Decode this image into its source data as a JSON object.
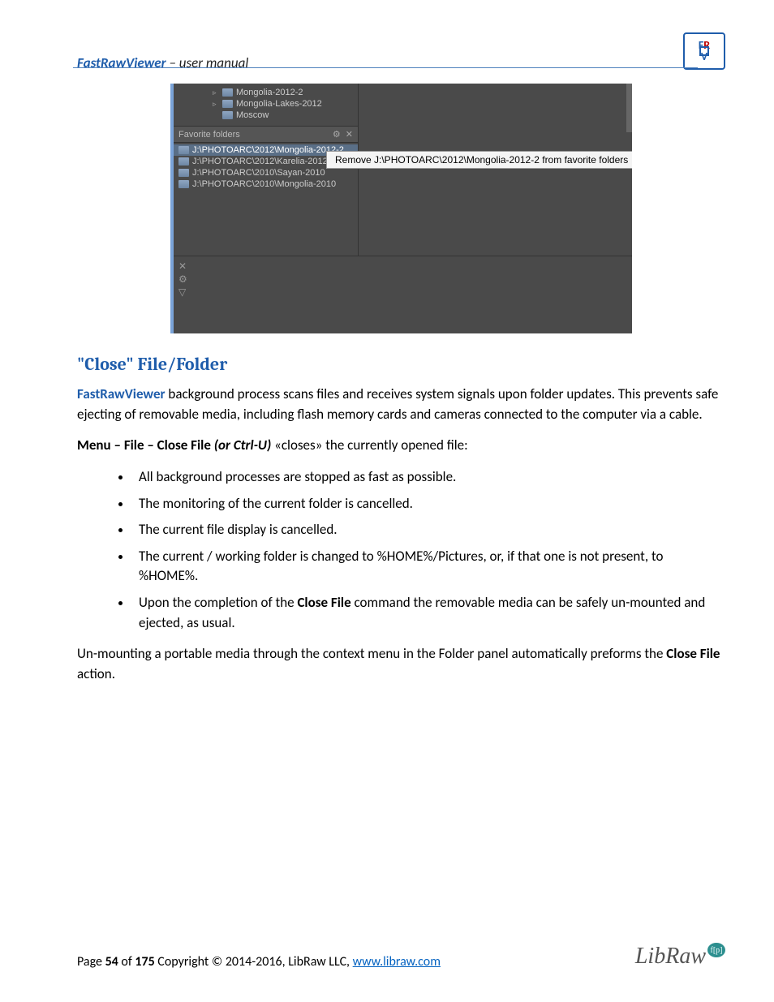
{
  "header": {
    "brand": "FastRawViewer",
    "suffix": " – user manual",
    "logo_text": "FRV"
  },
  "screenshot": {
    "tree": [
      {
        "label": "Mongolia-2012-2",
        "arrow": true
      },
      {
        "label": "Mongolia-Lakes-2012",
        "arrow": true
      },
      {
        "label": "Moscow",
        "arrow": false
      }
    ],
    "fav_header": "Favorite folders",
    "fav_icons": {
      "gear": "⚙",
      "close": "✕"
    },
    "favorites": [
      {
        "path": "J:\\PHOTOARC\\2012\\Mongolia-2012-2",
        "selected": true
      },
      {
        "path": "J:\\PHOTOARC\\2012\\Karelia-2012",
        "selected": false
      },
      {
        "path": "J:\\PHOTOARC\\2010\\Sayan-2010",
        "selected": false
      },
      {
        "path": "J:\\PHOTOARC\\2010\\Mongolia-2010",
        "selected": false
      }
    ],
    "context_menu_item": "Remove J:\\PHOTOARC\\2012\\Mongolia-2012-2 from favorite folders",
    "tool_icons": {
      "close": "✕",
      "gear": "⚙",
      "filter": "▽"
    }
  },
  "section_title": "\"Close\" File/Folder",
  "para1_brand": "FastRawViewer",
  "para1_rest": " background process scans files and receives system signals upon folder updates. This prevents safe ejecting of removable media, including flash memory cards and cameras connected to the computer via a cable.",
  "para2_prefix": "Menu – File – Close File ",
  "para2_italic": "(or Ctrl-U)",
  "para2_rest": " «closes» the currently opened file:",
  "bullets": [
    "All background processes are stopped as fast as possible.",
    "The monitoring of the current folder is cancelled.",
    "The current file display is cancelled.",
    "The current / working folder is changed to %HOME%/Pictures, or, if that one is not present, to %HOME%."
  ],
  "bullet5_pre": "Upon the completion of the ",
  "bullet5_bold": "Close File",
  "bullet5_post": " command the removable media can be safely un-mounted and ejected, as usual.",
  "para3_pre": "Un-mounting a portable media through the context menu in the Folder panel automatically preforms the ",
  "para3_bold": "Close File",
  "para3_post": " action.",
  "footer": {
    "page_label_pre": "Page ",
    "page_num": "54",
    "page_of": " of ",
    "page_total": "175",
    "copyright": " Copyright © 2014-2016, LibRaw LLC, ",
    "link": "www.libraw.com",
    "libraw_text": "LibRaw",
    "libraw_badge": "f[p]"
  }
}
